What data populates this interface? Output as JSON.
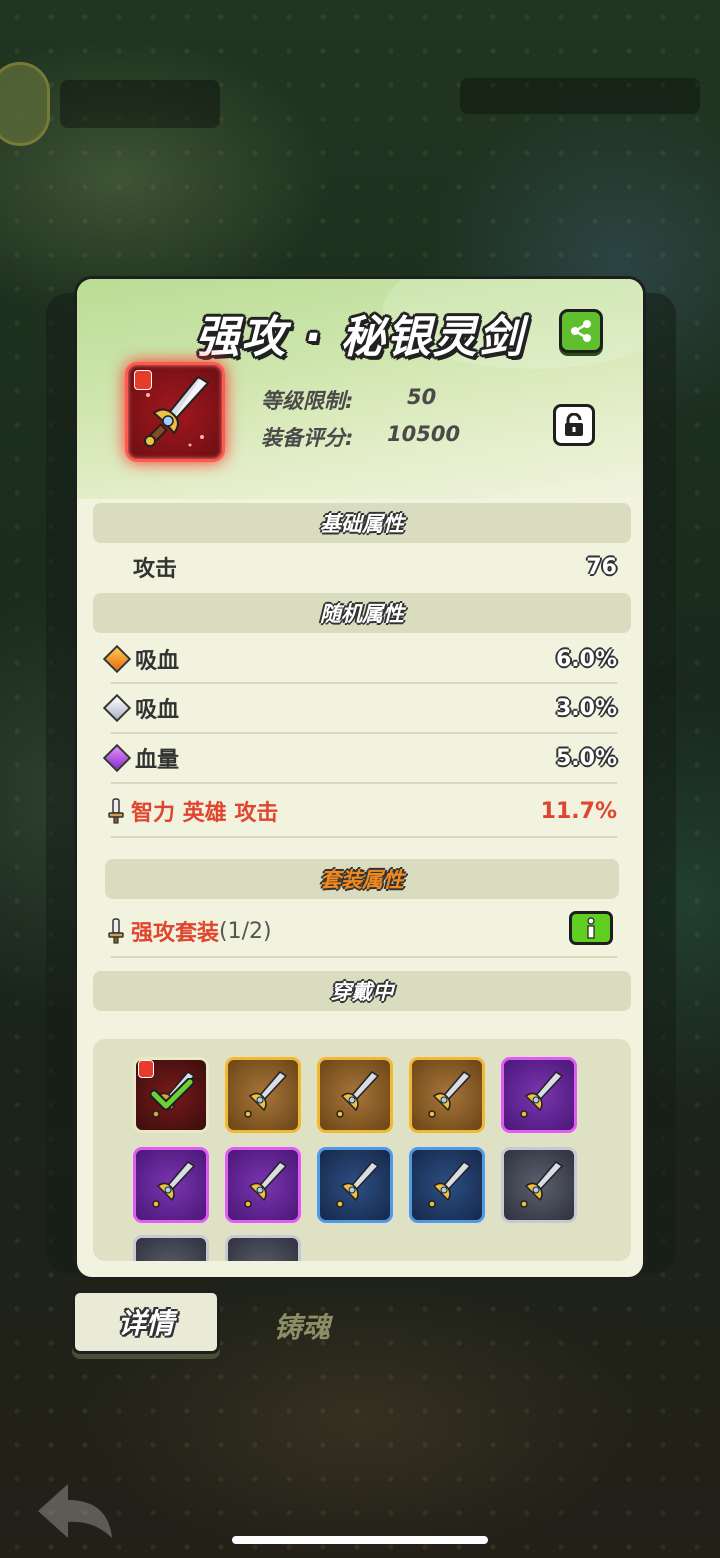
{
  "item": {
    "title": "强攻 · 秘银灵剑",
    "level_label": "等级限制:",
    "level_value": "50",
    "score_label": "装备评分:",
    "score_value": "10500"
  },
  "sections": {
    "base": "基础属性",
    "random": "随机属性",
    "set": "套装属性",
    "equipped": "穿戴中"
  },
  "base_stats": [
    {
      "label": "攻击",
      "value": "76"
    }
  ],
  "random_stats": [
    {
      "gem": "orange",
      "label": "吸血",
      "value": "6.0%"
    },
    {
      "gem": "silver",
      "label": "吸血",
      "value": "3.0%"
    },
    {
      "gem": "purple",
      "label": "血量",
      "value": "5.0%"
    },
    {
      "gem": "sword",
      "label": "智力 英雄 攻击",
      "value": "11.7%"
    }
  ],
  "set_bonus": {
    "label": "强攻套装",
    "count": "(1/2)"
  },
  "equipped_grid": [
    "red-checked",
    "gold",
    "gold",
    "gold",
    "purple",
    "purple",
    "purple",
    "blue",
    "blue",
    "grey",
    "grey",
    "grey"
  ],
  "tabs": {
    "details": "详情",
    "soul": "铸魂"
  },
  "colors": {
    "accent_red": "#e0452f",
    "button_green": "#5fbf2f",
    "panel_bg": "#f1f3de"
  }
}
